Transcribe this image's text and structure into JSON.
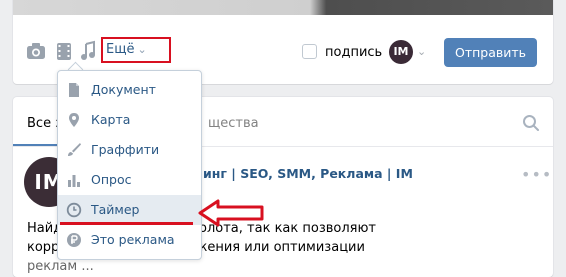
{
  "composer": {
    "more_label": "Ещё",
    "signature_label": "подпись",
    "author_initials": "IM",
    "send_label": "Отправить"
  },
  "feed": {
    "tab_all": "Все з",
    "tab_communities": "щества",
    "post_author": "инг | SEO, SMM, Реклама | IM",
    "post_avatar_initials": "IM",
    "post_lines": [
      "Найд                запросы — на вес золота, так как позволяют",
      "корр                поискового продвижения или оптимизации",
      "реклам              ..."
    ]
  },
  "dropdown": {
    "items": [
      {
        "label": "Документ",
        "icon": "document-icon"
      },
      {
        "label": "Карта",
        "icon": "map-pin-icon"
      },
      {
        "label": "Граффити",
        "icon": "brush-icon"
      },
      {
        "label": "Опрос",
        "icon": "poll-icon"
      },
      {
        "label": "Таймер",
        "icon": "clock-icon"
      },
      {
        "label": "Это реклама",
        "icon": "ruble-icon"
      }
    ],
    "hovered_item": "Таймер"
  },
  "colors": {
    "accent": "#5181b8",
    "link": "#2a5885",
    "annotation_red": "#d81020",
    "icon_gray": "#99a2ad"
  }
}
